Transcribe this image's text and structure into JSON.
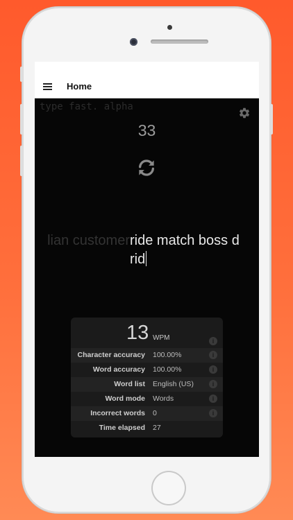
{
  "app_bar": {
    "title": "Home",
    "menu_icon": "hamburger-menu-icon"
  },
  "brand": "type fast. alpha",
  "settings_icon": "gear-icon",
  "timer": "33",
  "refresh_icon": "refresh-icon",
  "words": {
    "typed": "lian customer",
    "upcoming": "ride match boss d",
    "current_input": "rid"
  },
  "stats": {
    "wpm_value": "13",
    "wpm_unit": "WPM",
    "rows": [
      {
        "label": "Character accuracy",
        "value": "100.00%"
      },
      {
        "label": "Word accuracy",
        "value": "100.00%"
      },
      {
        "label": "Word list",
        "value": "English (US)"
      },
      {
        "label": "Word mode",
        "value": "Words"
      },
      {
        "label": "Incorrect words",
        "value": "0"
      },
      {
        "label": "Time elapsed",
        "value": "27"
      }
    ]
  }
}
